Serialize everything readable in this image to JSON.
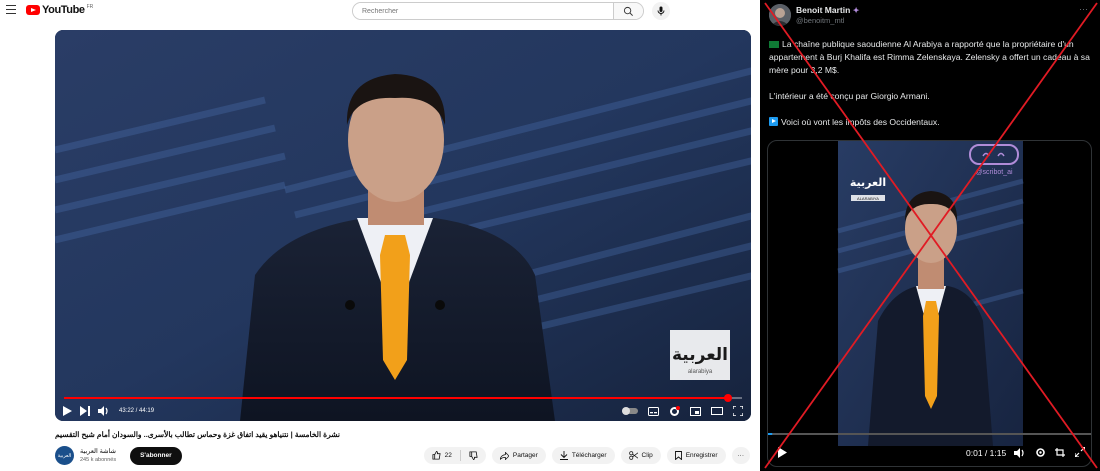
{
  "youtube": {
    "brand": "YouTube",
    "region": "FR",
    "search": {
      "placeholder": "Rechercher"
    },
    "player": {
      "time": "43:22 / 44:19",
      "progress": 0.979,
      "watermark_main": "العربية",
      "watermark_sub": "alarabiya"
    },
    "title": "نشرة الخامسة | نتنياهو يقيد اتفاق غزة وحماس تطالب بالأسرى.. والسودان أمام شبح التقسيم",
    "channel": {
      "avatar_text": "العربية",
      "name": "شاشة العربية",
      "subscribers": "245 k abonnés",
      "subscribe_label": "S'abonner"
    },
    "actions": {
      "likes": "22",
      "share": "Partager",
      "download": "Télécharger",
      "clip": "Clip",
      "save": "Enregistrer",
      "more": "···"
    }
  },
  "tweet": {
    "author": "Benoit Martin",
    "handle": "@benoitm_mtl",
    "more": "···",
    "paragraphs": [
      "La chaîne publique saoudienne Al Arabiya a rapporté que la propriétaire d'un appartement à Burj Khalifa est Rimma Zelenskaya. Zelensky a offert un cadeau à sa mère pour 3,2 M$.",
      "L'intérieur a été conçu par Giorgio Armani.",
      "Voici où vont les impôts des Occidentaux."
    ],
    "media": {
      "logo_main": "العربية",
      "date_tag": "ALARABIYA",
      "watermark": "@scribot_ai",
      "time": "0:01 / 1:15",
      "progress": 0.013
    }
  },
  "colors": {
    "youtube_red": "#ff0000",
    "tweet_bg": "#000000",
    "cross_red": "#e01b24",
    "tie_orange": "#f2a01a"
  }
}
